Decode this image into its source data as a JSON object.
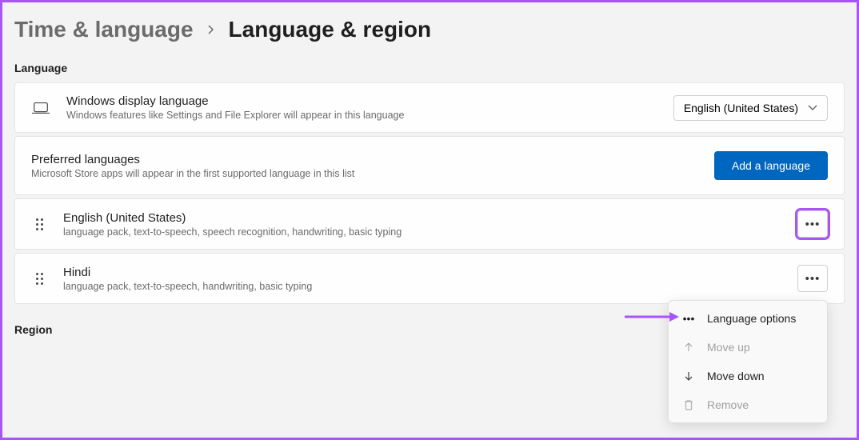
{
  "breadcrumb": {
    "parent": "Time & language",
    "current": "Language & region"
  },
  "sections": {
    "language_label": "Language",
    "region_label": "Region"
  },
  "display_language": {
    "title": "Windows display language",
    "subtitle": "Windows features like Settings and File Explorer will appear in this language",
    "selected": "English (United States)"
  },
  "preferred": {
    "title": "Preferred languages",
    "subtitle": "Microsoft Store apps will appear in the first supported language in this list",
    "add_button": "Add a language"
  },
  "languages": [
    {
      "name": "English (United States)",
      "features": "language pack, text-to-speech, speech recognition, handwriting, basic typing"
    },
    {
      "name": "Hindi",
      "features": "language pack, text-to-speech, handwriting, basic typing"
    }
  ],
  "context_menu": {
    "language_options": "Language options",
    "move_up": "Move up",
    "move_down": "Move down",
    "remove": "Remove"
  }
}
